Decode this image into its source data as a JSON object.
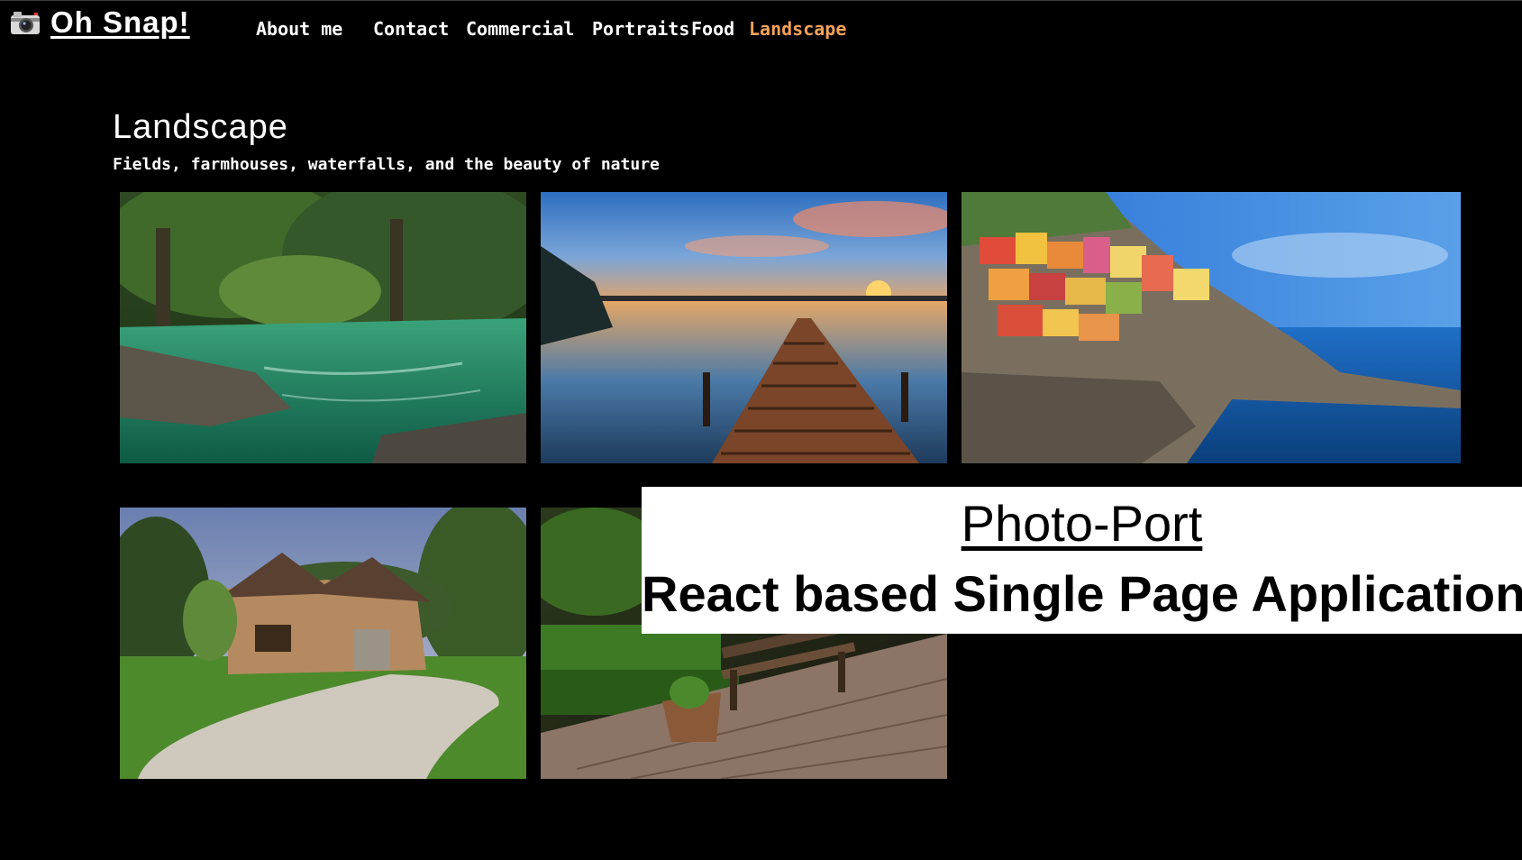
{
  "header": {
    "brand": "Oh Snap!",
    "brand_icon": "camera-icon",
    "nav": [
      {
        "label": "About me"
      },
      {
        "label": "Contact"
      },
      {
        "label": "Commercial"
      },
      {
        "label": "Portraits"
      },
      {
        "label": "Food"
      },
      {
        "label": "Landscape",
        "active": true
      }
    ],
    "accent_color": "#f4a259"
  },
  "main": {
    "title": "Landscape",
    "subtitle": "Fields, farmhouses, waterfalls, and the beauty of nature",
    "photos": [
      {
        "subject": "green-river-forest"
      },
      {
        "subject": "lake-pier-sunset"
      },
      {
        "subject": "cliffside-village-sea"
      },
      {
        "subject": "stone-farmhouse-lawn"
      },
      {
        "subject": "garden-bench-patio"
      }
    ]
  },
  "overlay": {
    "title": "Photo-Port",
    "subtitle": "React based Single Page Application"
  }
}
